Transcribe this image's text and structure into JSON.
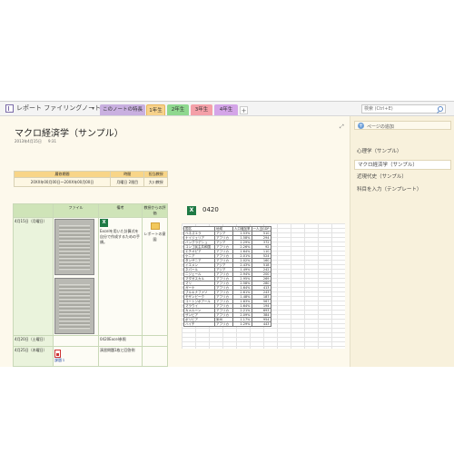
{
  "notebook": {
    "title": "レポート ファイリングノート",
    "caret": "▾"
  },
  "tabs": [
    {
      "label": "このノートの特長"
    },
    {
      "label": "1年生"
    },
    {
      "label": "2年生"
    },
    {
      "label": "3年生"
    },
    {
      "label": "4年生"
    }
  ],
  "add_tab": "+",
  "search": {
    "placeholder": "検索 (Ctrl+E)"
  },
  "page": {
    "title": "マクロ経済学（サンプル）",
    "date": "2013年4月15日",
    "time": "9:31",
    "info_table": {
      "headers": [
        "履修期間",
        "時間",
        "担当教授"
      ],
      "values": [
        "20XX年00月00日～20XX年00月00日",
        "月曜日 2限目",
        "大川教授"
      ]
    },
    "main_table": {
      "headers": [
        "",
        "ファイル",
        "備考",
        "教授からの評価"
      ],
      "rows": [
        {
          "date": "4月15日（月曜日）",
          "note": "Excelを用いた計算式を自分で作成するための手順。",
          "eval": "レポートの意図"
        },
        {
          "date": "4月20日（土曜日）",
          "note": "0420Excel参照",
          "eval": ""
        },
        {
          "date": "4月25日（木曜日）",
          "file": "課題１",
          "note": "演習問題1枚と回答例",
          "eval": ""
        }
      ]
    },
    "excel_title": "0420"
  },
  "sheet": {
    "headers": [
      "国名",
      "地域",
      "人口増加率",
      "一人当GDP"
    ],
    "rows": [
      [
        "ベネズエラ",
        "アジア",
        "1.53%",
        "510"
      ],
      [
        "ナイジェリア",
        "アフリカ",
        "1.58%",
        "294"
      ],
      [
        "バングラデシュ",
        "アジア",
        "1.29%",
        "372"
      ],
      [
        "コンゴ民主共和国",
        "アフリカ",
        "2.26%",
        "92"
      ],
      [
        "エチオピア",
        "アフリカ",
        "1.64%",
        "110"
      ],
      [
        "ケニア",
        "アフリカ",
        "2.01%",
        "524"
      ],
      [
        "タンザニア",
        "アフリカ",
        "2.02%",
        "160"
      ],
      [
        "イエメン",
        "アジア",
        "2.43%",
        "518"
      ],
      [
        "ネパール",
        "アジア",
        "1.49%",
        "242"
      ],
      [
        "ニジェール",
        "アフリカ",
        "2.94%",
        "200"
      ],
      [
        "マダガスカル",
        "アフリカ",
        "2.95%",
        "269"
      ],
      [
        "マリ",
        "アフリカ",
        "2.58%",
        "280"
      ],
      [
        "ガーナ",
        "アフリカ",
        "1.64%",
        "413"
      ],
      [
        "ブルキナファソ",
        "アフリカ",
        "2.61%",
        "243"
      ],
      [
        "モザンビーク",
        "アフリカ",
        "1.48%",
        "187"
      ],
      [
        "コートジボアール",
        "アフリカ",
        "1.83%",
        "567"
      ],
      [
        "マラウイ",
        "アフリカ",
        "1.64%",
        "194"
      ],
      [
        "カメルーン",
        "アフリカ",
        "2.21%",
        "693"
      ],
      [
        "ザンビア",
        "アフリカ",
        "2.09%",
        "384"
      ],
      [
        "ボリビア",
        "米州",
        "1.17%",
        "954"
      ],
      [
        "ハイチ",
        "アフリカ",
        "1.29%",
        "443"
      ]
    ]
  },
  "pages_pane": {
    "add_label": "ページの追加",
    "items": [
      {
        "label": "心理学（サンプル）"
      },
      {
        "label": "マクロ経済学（サンプル）"
      },
      {
        "label": "近現代史（サンプル）"
      },
      {
        "label": "科目を入力（テンプレート）"
      }
    ]
  }
}
